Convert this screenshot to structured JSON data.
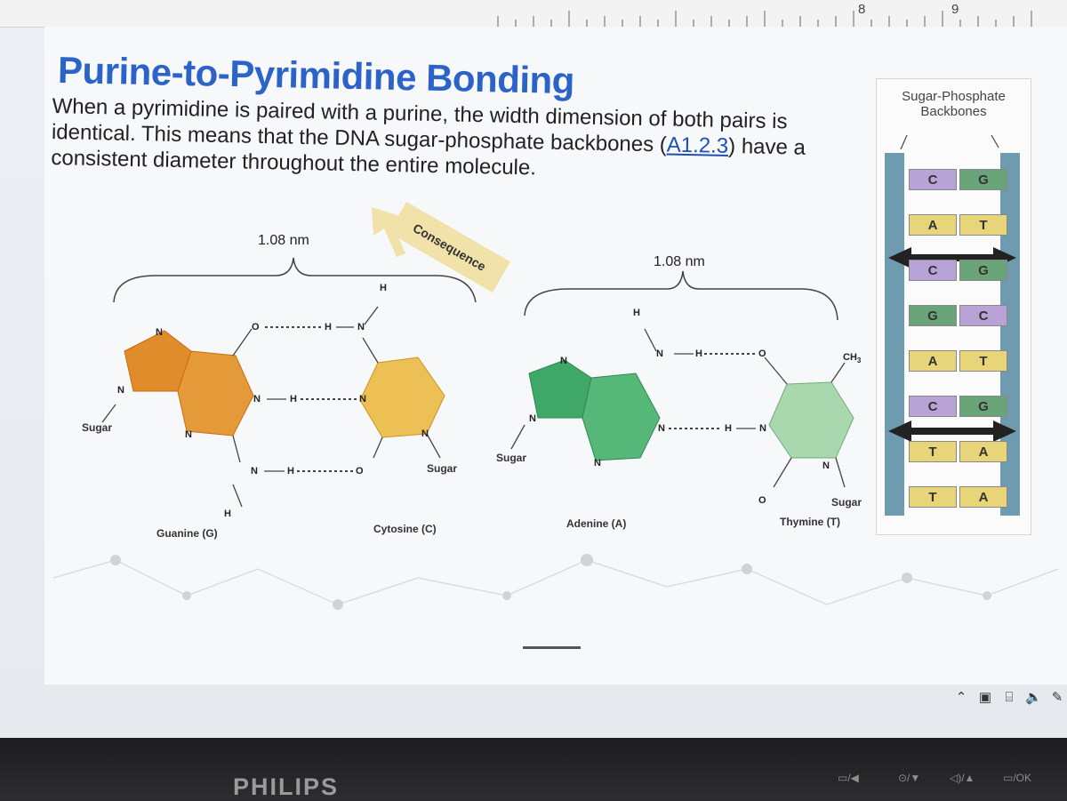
{
  "ruler": {
    "marks": [
      "8",
      "9"
    ]
  },
  "slide": {
    "title": "Purine-to-Pyrimidine Bonding",
    "body_pre": "When a pyrimidine is paired with a purine, the width dimension of both pairs is identical.  This means that the DNA sugar-phosphate backbones (",
    "body_link": "A1.2.3",
    "body_post": ") have a consistent diameter throughout the entire molecule.",
    "consequence_label": "Consequence"
  },
  "diagram": {
    "left_pair": {
      "width_label": "1.08 nm",
      "purine_name": "Guanine (G)",
      "pyrimidine_name": "Cytosine (C)"
    },
    "right_pair": {
      "width_label": "1.08 nm",
      "purine_name": "Adenine (A)",
      "pyrimidine_name": "Thymine (T)",
      "methyl": "CH"
    },
    "sugar_label": "Sugar",
    "atoms": {
      "N": "N",
      "H": "H",
      "O": "O"
    }
  },
  "ladder": {
    "caption": "Sugar-Phosphate Backbones",
    "pairs": [
      {
        "left": "C",
        "right": "G"
      },
      {
        "left": "A",
        "right": "T"
      },
      {
        "left": "C",
        "right": "G"
      },
      {
        "left": "G",
        "right": "C"
      },
      {
        "left": "A",
        "right": "T"
      },
      {
        "left": "C",
        "right": "G"
      },
      {
        "left": "T",
        "right": "A"
      },
      {
        "left": "T",
        "right": "A"
      }
    ],
    "colors": {
      "C": "#b9a3d6",
      "G": "#6aa57a",
      "A": "#e8d57a",
      "T": "#e8d57a",
      "backbone": "#6f9bb0"
    }
  },
  "taskbar": {
    "icons": [
      "chevron-up-icon",
      "app-icon",
      "network-icon",
      "volume-icon",
      "pen-icon"
    ]
  },
  "monitor": {
    "brand": "PHILIPS",
    "buttons": [
      "▭/◀",
      "⊙/▼",
      "◁)/▲",
      "▭/OK"
    ]
  }
}
